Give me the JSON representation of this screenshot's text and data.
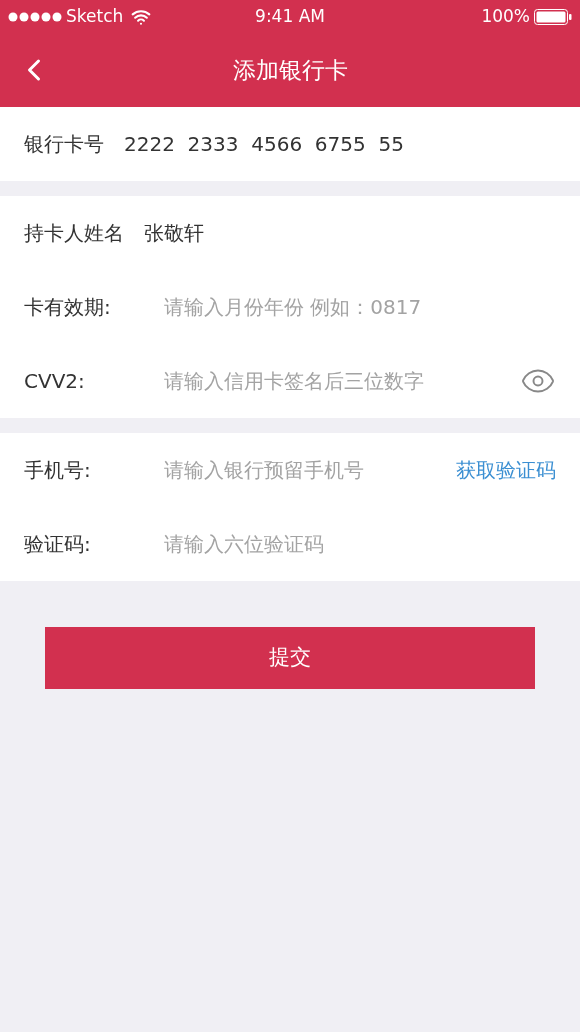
{
  "status_bar": {
    "carrier": "Sketch",
    "time": "9:41 AM",
    "battery": "100%"
  },
  "nav": {
    "title": "添加银行卡"
  },
  "sections": [
    [
      {
        "kind": "value",
        "label": "银行卡号",
        "value": "2222  2333  4566  6755  55"
      }
    ],
    [
      {
        "kind": "value",
        "label": "持卡人姓名",
        "value": "张敬轩"
      },
      {
        "kind": "input",
        "label": "卡有效期:",
        "placeholder": "请输入月份年份 例如：0817"
      },
      {
        "kind": "password",
        "label": "CVV2:",
        "placeholder": "请输入信用卡签名后三位数字"
      }
    ],
    [
      {
        "kind": "code",
        "label": "手机号:",
        "placeholder": "请输入银行预留手机号",
        "action": "获取验证码"
      },
      {
        "kind": "input",
        "label": "验证码:",
        "placeholder": "请输入六位验证码"
      }
    ]
  ],
  "submit": "提交"
}
